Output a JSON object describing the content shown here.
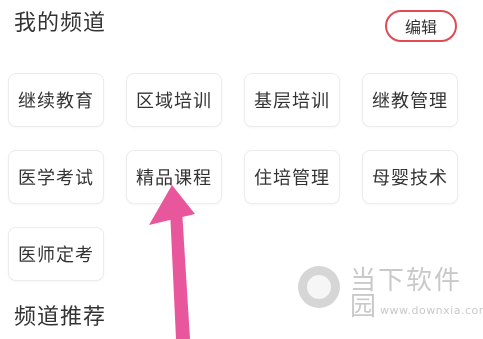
{
  "my_channels": {
    "title": "我的频道",
    "edit_label": "编辑",
    "items": [
      {
        "label": "继续教育"
      },
      {
        "label": "区域培训"
      },
      {
        "label": "基层培训"
      },
      {
        "label": "继教管理"
      },
      {
        "label": "医学考试"
      },
      {
        "label": "精品课程"
      },
      {
        "label": "住培管理"
      },
      {
        "label": "母婴技术"
      },
      {
        "label": "医师定考"
      }
    ]
  },
  "recommended": {
    "title": "频道推荐"
  },
  "annotation": {
    "arrow_color": "#e8579b",
    "arrow_target": "精品课程"
  },
  "watermark": {
    "name": "当下软件园",
    "url": "www.downxia.com"
  },
  "colors": {
    "accent_border": "#e04a55",
    "text": "#333333",
    "chip_border": "#ececec"
  }
}
